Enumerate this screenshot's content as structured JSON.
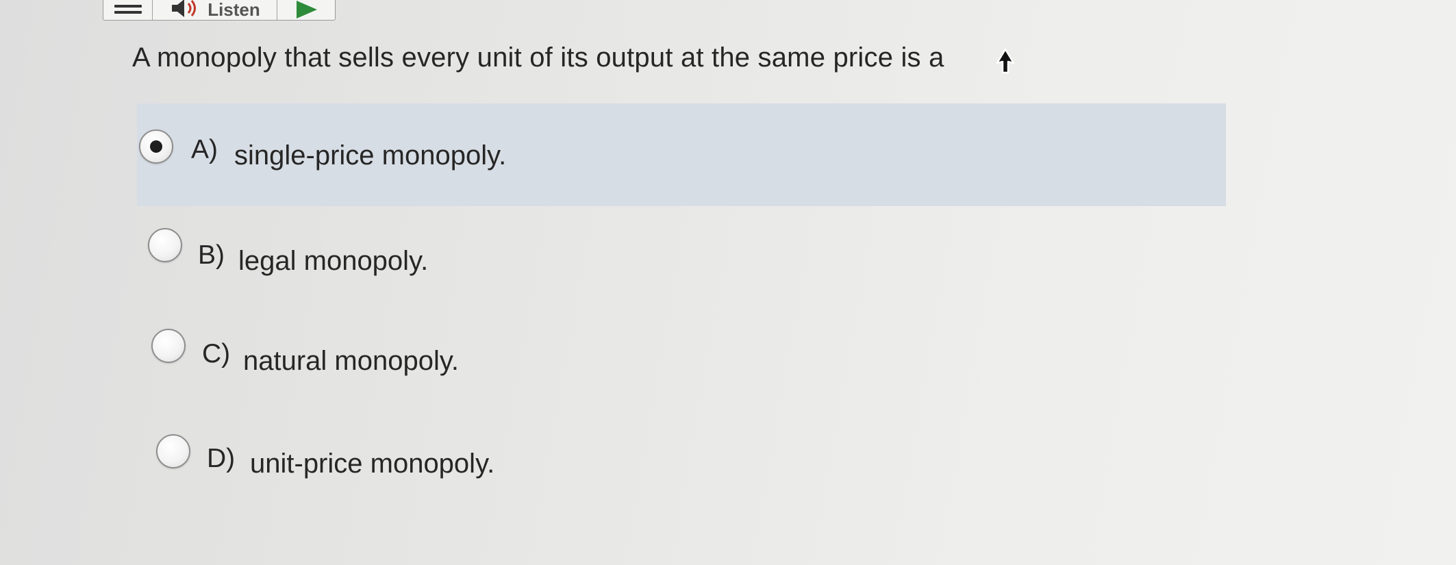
{
  "toolbar": {
    "menu_icon": "hamburger-menu-icon",
    "listen_icon": "speaker-icon",
    "listen_label": "Listen",
    "play_icon": "play-icon",
    "accent_color": "#2e8b3a",
    "speaker_color": "#c0392b"
  },
  "question": {
    "text": "A monopoly that sells every unit of its output at the same price is a"
  },
  "options": [
    {
      "letter": "A)",
      "text": "single-price monopoly.",
      "selected": true
    },
    {
      "letter": "B)",
      "text": "legal monopoly.",
      "selected": false
    },
    {
      "letter": "C)",
      "text": "natural monopoly.",
      "selected": false
    },
    {
      "letter": "D)",
      "text": "unit-price monopoly.",
      "selected": false
    }
  ],
  "colors": {
    "selected_row": "#d7dde4",
    "text": "#262626"
  }
}
